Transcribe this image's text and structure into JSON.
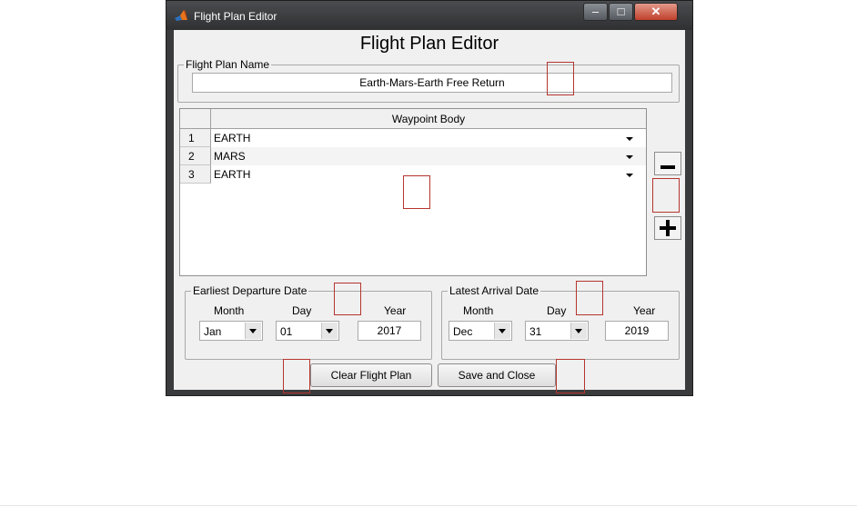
{
  "window": {
    "title": "Flight Plan Editor",
    "icon": "matlab-logo-icon",
    "caption_buttons": {
      "minimize": "–",
      "maximize": "□",
      "close": "✕"
    }
  },
  "dialog": {
    "heading": "Flight Plan Editor",
    "flight_plan_name": {
      "legend": "Flight Plan Name",
      "value": "Earth-Mars-Earth Free Return"
    }
  },
  "waypoints": {
    "column_header": "Waypoint Body",
    "rows": [
      {
        "num": "1",
        "body": "EARTH"
      },
      {
        "num": "2",
        "body": "MARS"
      },
      {
        "num": "3",
        "body": "EARTH"
      }
    ],
    "remove_button": "−",
    "add_button": "+"
  },
  "departure": {
    "legend": "Earliest Departure Date",
    "month_label": "Month",
    "day_label": "Day",
    "year_label": "Year",
    "month": "Jan",
    "day": "01",
    "year": "2017"
  },
  "arrival": {
    "legend": "Latest Arrival Date",
    "month_label": "Month",
    "day_label": "Day",
    "year_label": "Year",
    "month": "Dec",
    "day": "31",
    "year": "2019"
  },
  "buttons": {
    "clear": "Clear Flight Plan",
    "save": "Save and Close"
  },
  "colors": {
    "highlight_box": "#b5352f",
    "window_frame": "#3a3b3d",
    "close_button": "#c0402c"
  }
}
